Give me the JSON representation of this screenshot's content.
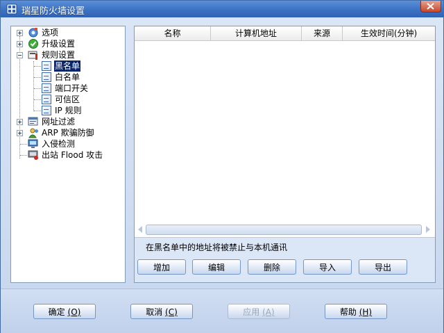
{
  "window": {
    "title": "瑞星防火墙设置"
  },
  "tree": {
    "items": [
      {
        "label": "选项"
      },
      {
        "label": "升级设置"
      },
      {
        "label": "规则设置"
      },
      {
        "label": "黑名单"
      },
      {
        "label": "白名单"
      },
      {
        "label": "端口开关"
      },
      {
        "label": "可信区"
      },
      {
        "label": "IP 规则"
      },
      {
        "label": "网址过滤"
      },
      {
        "label": "ARP 欺骗防御"
      },
      {
        "label": "入侵检测"
      },
      {
        "label": "出站 Flood 攻击"
      }
    ]
  },
  "list": {
    "columns": [
      "名称",
      "计算机地址",
      "来源",
      "生效时间(分钟)"
    ],
    "rows": []
  },
  "info_text": "在黑名单中的地址将被禁止与本机通讯",
  "actions": {
    "add": "增加",
    "edit": "编辑",
    "delete": "删除",
    "import": "导入",
    "export": "导出"
  },
  "footer": {
    "ok": {
      "label": "确定",
      "accel": "(O)"
    },
    "cancel": {
      "label": "取消",
      "accel": "(C)"
    },
    "apply": {
      "label": "应用",
      "accel": "(A)"
    },
    "help": {
      "label": "帮助",
      "accel": "(H)"
    }
  },
  "colors": {
    "titlebar": "#3c72c4",
    "selection": "#0a246a",
    "panel_border": "#7f9db9"
  }
}
